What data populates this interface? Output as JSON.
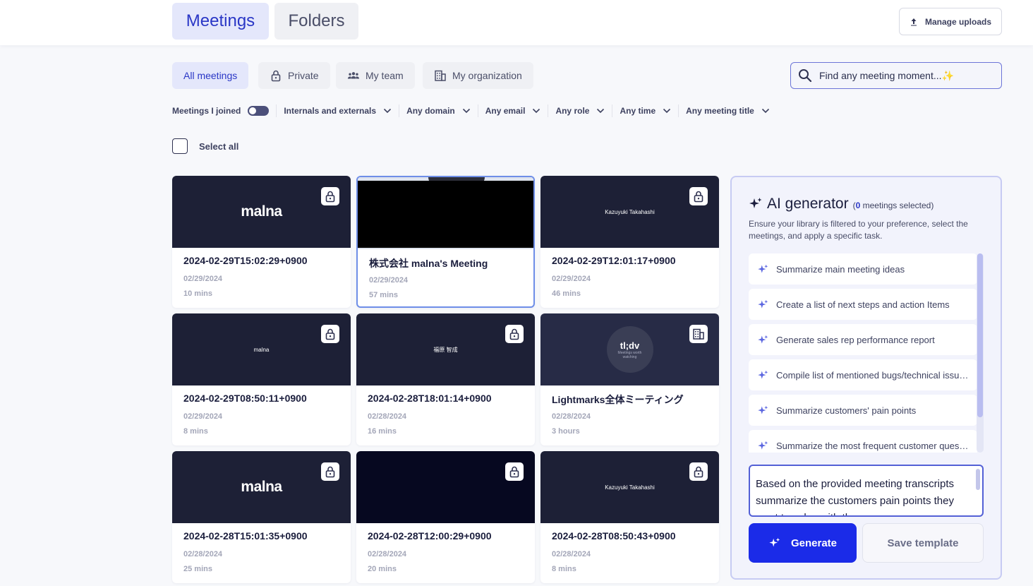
{
  "header": {
    "tabs": [
      {
        "label": "Meetings",
        "active": true
      },
      {
        "label": "Folders",
        "active": false
      }
    ],
    "manage_uploads": "Manage uploads"
  },
  "scope_tabs": [
    {
      "label": "All meetings",
      "icon": null,
      "active": true
    },
    {
      "label": "Private",
      "icon": "lock-icon",
      "active": false
    },
    {
      "label": "My team",
      "icon": "team-icon",
      "active": false
    },
    {
      "label": "My organization",
      "icon": "building-icon",
      "active": false
    }
  ],
  "search": {
    "placeholder": "Find any meeting moment...✨"
  },
  "filters": {
    "meetings_joined": "Meetings I joined",
    "dropdowns": [
      "Internals and externals",
      "Any domain",
      "Any email",
      "Any role",
      "Any time",
      "Any meeting title"
    ]
  },
  "select_all": "Select all",
  "meetings": [
    {
      "title": "2024-02-29T15:02:29+0900",
      "date": "02/29/2024",
      "duration": "10 mins",
      "thumb_text": "malna",
      "thumb_style": "big",
      "badge": "lock-icon"
    },
    {
      "title": "株式会社 malna's Meeting",
      "date": "02/29/2024",
      "duration": "57 mins",
      "thumb_text": "",
      "thumb_style": "video",
      "badge": null
    },
    {
      "title": "2024-02-29T12:01:17+0900",
      "date": "02/29/2024",
      "duration": "46 mins",
      "thumb_text": "Kazuyuki Takahashi",
      "thumb_style": "small",
      "badge": "lock-icon"
    },
    {
      "title": "2024-02-29T08:50:11+0900",
      "date": "02/29/2024",
      "duration": "8 mins",
      "thumb_text": "malna",
      "thumb_style": "small",
      "badge": "lock-icon"
    },
    {
      "title": "2024-02-28T18:01:14+0900",
      "date": "02/28/2024",
      "duration": "16 mins",
      "thumb_text": "福原 智成",
      "thumb_style": "small",
      "badge": "lock-icon"
    },
    {
      "title": "Lightmarks全体ミーティング",
      "date": "02/28/2024",
      "duration": "3 hours",
      "thumb_text": "tl;dv",
      "thumb_sub": "Meetings worth watching",
      "thumb_style": "tldv",
      "badge": "building-icon"
    },
    {
      "title": "2024-02-28T15:01:35+0900",
      "date": "02/28/2024",
      "duration": "25 mins",
      "thumb_text": "malna",
      "thumb_style": "big",
      "badge": "lock-icon"
    },
    {
      "title": "2024-02-28T12:00:29+0900",
      "date": "02/28/2024",
      "duration": "20 mins",
      "thumb_text": "",
      "thumb_style": "dark",
      "badge": "lock-icon"
    },
    {
      "title": "2024-02-28T08:50:43+0900",
      "date": "02/28/2024",
      "duration": "8 mins",
      "thumb_text": "Kazuyuki Takahashi",
      "thumb_style": "small",
      "badge": "lock-icon"
    }
  ],
  "ai": {
    "title": "AI generator",
    "count_open": "(",
    "count": "0",
    "count_suffix": " meetings selected)",
    "description": "Ensure your library is filtered to your preference, select the meetings, and apply a specific task.",
    "templates": [
      "Summarize main meeting ideas",
      "Create a list of next steps and action Items",
      "Generate sales rep performance report",
      "Compile list of mentioned bugs/technical issues",
      "Summarize customers' pain points",
      "Summarize the most frequent customer questions"
    ],
    "prompt": "Based on the provided meeting transcripts summarize the customers pain points they want to solve with the",
    "generate": "Generate",
    "save_template": "Save template"
  },
  "colors": {
    "accent": "#1b2be8",
    "accent_light": "#e4e7fb",
    "thumb_bg": "#1d2036"
  }
}
